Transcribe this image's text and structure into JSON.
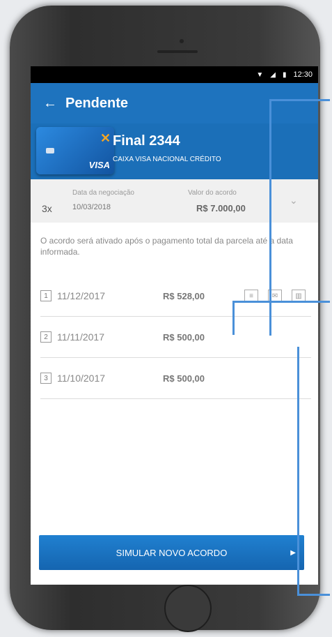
{
  "status": {
    "time": "12:30"
  },
  "appbar": {
    "back": "←",
    "title": "Pendente"
  },
  "card": {
    "title": "Final 2344",
    "subtitle": "CAIXA VISA NACIONAL CRÉDITO",
    "brand": "VISA"
  },
  "summary": {
    "installments": "3x",
    "date_label": "Data da negociação",
    "date": "10/03/2018",
    "value_label": "Valor do acordo",
    "value": "R$ 7.000,00",
    "chevron": "⌄"
  },
  "notice": "O acordo será ativado após o pagamento total da parcela até a data informada.",
  "installments": [
    {
      "num": "1",
      "date": "11/12/2017",
      "amount": "R$ 528,00"
    },
    {
      "num": "2",
      "date": "11/11/2017",
      "amount": "R$ 500,00"
    },
    {
      "num": "3",
      "date": "11/10/2017",
      "amount": "R$ 500,00"
    }
  ],
  "icons": {
    "doc": "document-icon",
    "mail": "mail-icon",
    "barcode": "barcode-icon"
  },
  "button": {
    "label": "SIMULAR NOVO ACORDO",
    "arrow": "▶"
  },
  "colors": {
    "primary": "#1e73be",
    "statusbar": "#000000",
    "connector": "#4a90d9"
  }
}
